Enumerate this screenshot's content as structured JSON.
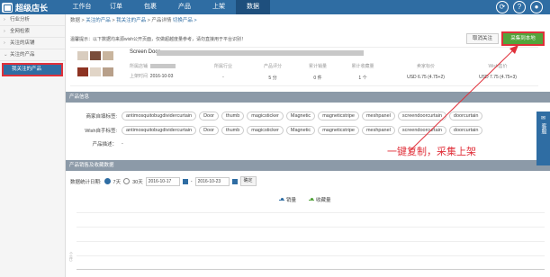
{
  "app": {
    "title": "超级店长"
  },
  "nav": [
    {
      "label": "工作台"
    },
    {
      "label": "订单"
    },
    {
      "label": "包裹"
    },
    {
      "label": "产品"
    },
    {
      "label": "上架"
    },
    {
      "label": "数据"
    }
  ],
  "sidebar": {
    "items": [
      {
        "label": "行业分析"
      },
      {
        "label": "全网检索"
      },
      {
        "label": "关注的店铺"
      },
      {
        "label": "关注的产品"
      }
    ],
    "active_sub": "我关注的产品"
  },
  "breadcrumb": {
    "prefix": "数据 > ",
    "link1": "关注的产品",
    "sep1": " > ",
    "link2": "我关注的产品",
    "sep2": " > 产品详情 ",
    "switch": "切换产品 >"
  },
  "notice": "温馨提示：以下数据均来源wish公开页面，仅做超越度量参考，请勿直接用于平台识别！",
  "buttons": {
    "cancel": "取消关注",
    "collect": "采集到本地"
  },
  "product": {
    "name": "Screen Door",
    "label_store": "所属店铺",
    "label_date": "上架时间",
    "date": "2016-10-03",
    "stats": [
      {
        "label": "所属行业",
        "value": "-"
      },
      {
        "label": "产品评分",
        "value": "5 分"
      },
      {
        "label": "累计销量",
        "value": "0 件"
      },
      {
        "label": "累计收藏量",
        "value": "1 个"
      },
      {
        "label": "卖家标价",
        "value": "USD 6.75 (4.75+2)"
      },
      {
        "label": "Wish售价",
        "value": "USD 7.75 (4.75+3)"
      }
    ]
  },
  "info_section": {
    "title": "产品信息",
    "seller_tags_label": "商家自填标签:",
    "seller_tags": [
      "antimosquitobugdividercurtain",
      "Door",
      "thumb",
      "magicsticker",
      "Magnetic",
      "magneticstripe",
      "meshpanel",
      "screendoorcurtain",
      "doorcurtain"
    ],
    "wish_tags_label": "Wish自手标签:",
    "wish_tags": [
      "antimosquitobugdividercurtain",
      "Door",
      "thumb",
      "magicsticker",
      "Magnetic",
      "magneticstripe",
      "meshpanel",
      "screendoorcurtain",
      "doorcurtain"
    ],
    "desc_label": "产品描述：",
    "desc": "-"
  },
  "sales_section": {
    "title": "产品销售及收藏数据",
    "range_label": "数据统计日期:",
    "opt7": "7天",
    "opt30": "30天",
    "start": "2016-10-17",
    "end": "2016-10-23",
    "ok": "确定",
    "legend_sales": "销量",
    "legend_fav": "收藏量",
    "y_unit": "个(件)"
  },
  "chart_data": {
    "type": "line",
    "categories": [],
    "series": [
      {
        "name": "销量",
        "values": []
      },
      {
        "name": "收藏量",
        "values": []
      }
    ]
  },
  "sidebtn": "客服",
  "annotation": "一键复制，采集上架",
  "colors": {
    "primary": "#2f6da3",
    "green": "#52a43b",
    "red": "#e0303a",
    "sales": "#2f6da3",
    "fav": "#52a43b"
  }
}
